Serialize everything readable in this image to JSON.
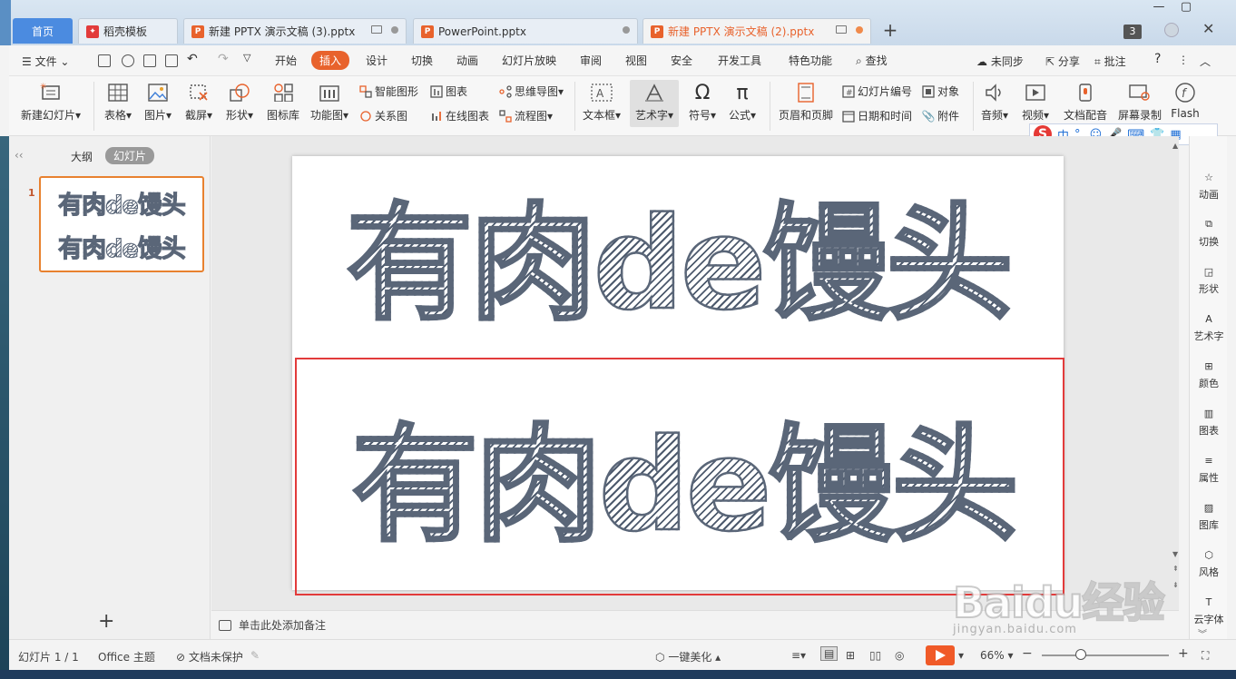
{
  "tabs": {
    "home": "首页",
    "template": "稻壳模板",
    "doc1": "新建 PPTX 演示文稿 (3).pptx",
    "doc2": "PowerPoint.pptx",
    "doc3": "新建 PPTX 演示文稿 (2).pptx",
    "window_count": "3"
  },
  "menu": {
    "file": "文件",
    "tabs": [
      "开始",
      "插入",
      "设计",
      "切换",
      "动画",
      "幻灯片放映",
      "审阅",
      "视图",
      "安全",
      "开发工具",
      "特色功能"
    ],
    "active_tab": "插入",
    "search": "查找",
    "sync": "未同步",
    "share": "分享",
    "comment": "批注",
    "help": "?"
  },
  "ribbon": {
    "new_slide": "新建幻灯片",
    "table": "表格",
    "picture": "图片",
    "screenshot": "截屏",
    "shape": "形状",
    "icon_lib": "图标库",
    "func_chart": "功能图",
    "smart_shape": "智能图形",
    "relation": "关系图",
    "chart": "图表",
    "online_chart": "在线图表",
    "mindmap": "思维导图",
    "flowchart": "流程图",
    "textbox": "文本框",
    "wordart": "艺术字",
    "symbol": "符号",
    "formula": "公式",
    "header_footer": "页眉和页脚",
    "slide_number": "幻灯片编号",
    "datetime": "日期和时间",
    "object": "对象",
    "attachment": "附件",
    "audio": "音频",
    "video": "视频",
    "doc_dub": "文档配音",
    "screen_rec": "屏幕录制",
    "flash": "Flash"
  },
  "ime": {
    "mode": "中",
    "punct": "°,"
  },
  "leftpane": {
    "outline": "大纲",
    "slides": "幻灯片",
    "slide_number": "1",
    "thumb_line1": "有肉de馒头",
    "thumb_line2": "有肉de馒头"
  },
  "slide": {
    "text1": "有肉de馒头",
    "text2": "有肉de馒头"
  },
  "notes": {
    "placeholder": "单击此处添加备注"
  },
  "rightpanel": [
    "动画",
    "切换",
    "形状",
    "艺术字",
    "颜色",
    "图表",
    "属性",
    "图库",
    "风格",
    "云字体"
  ],
  "status": {
    "slide_counter": "幻灯片 1 / 1",
    "theme": "Office 主题",
    "protect": "文档未保护",
    "beautify": "一键美化",
    "zoom": "66%"
  },
  "watermark": {
    "logo": "Baidu经验",
    "url": "jingyan.baidu.com"
  },
  "colors": {
    "accent": "#e8622c",
    "home_tab": "#4b8be0",
    "selection": "#e23b3b",
    "text_hatch": "#4d5a6d"
  }
}
